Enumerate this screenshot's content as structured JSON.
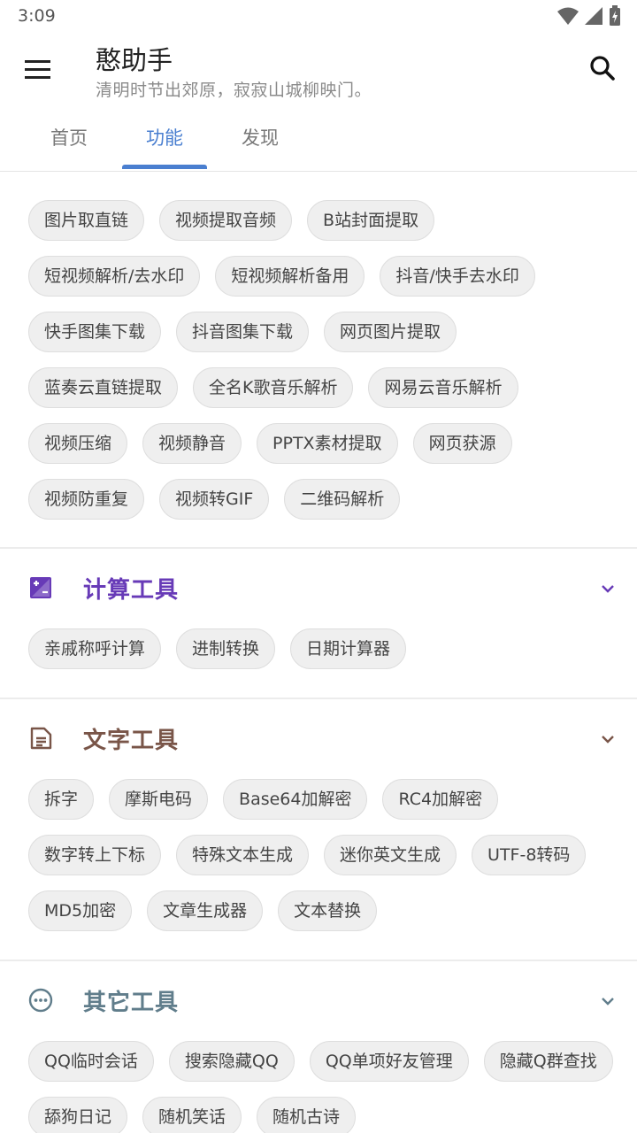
{
  "status_bar": {
    "time": "3:09"
  },
  "app_bar": {
    "title": "憨助手",
    "subtitle": "清明时节出郊原，寂寂山城柳映门。"
  },
  "tabs": [
    {
      "label": "首页"
    },
    {
      "label": "功能"
    },
    {
      "label": "发现"
    }
  ],
  "features": {
    "chips": [
      "图片取直链",
      "视频提取音频",
      "B站封面提取",
      "短视频解析/去水印",
      "短视频解析备用",
      "抖音/快手去水印",
      "快手图集下载",
      "抖音图集下载",
      "网页图片提取",
      "蓝奏云直链提取",
      "全名K歌音乐解析",
      "网易云音乐解析",
      "视频压缩",
      "视频静音",
      "PPTX素材提取",
      "网页获源",
      "视频防重复",
      "视频转GIF",
      "二维码解析"
    ]
  },
  "calc_tools": {
    "title": "计算工具",
    "color": "#673ab7",
    "icon": "calculator-icon",
    "chips": [
      "亲戚称呼计算",
      "进制转换",
      "日期计算器"
    ]
  },
  "text_tools": {
    "title": "文字工具",
    "color": "#795548",
    "icon": "document-icon",
    "chips": [
      "拆字",
      "摩斯电码",
      "Base64加解密",
      "RC4加解密",
      "数字转上下标",
      "特殊文本生成",
      "迷你英文生成",
      "UTF-8转码",
      "MD5加密",
      "文章生成器",
      "文本替换"
    ]
  },
  "other_tools": {
    "title": "其它工具",
    "color": "#607d8b",
    "icon": "more-horizontal-icon",
    "chips": [
      "QQ临时会话",
      "搜索隐藏QQ",
      "QQ单项好友管理",
      "隐藏Q群查找",
      "舔狗日记",
      "随机笑话",
      "随机古诗"
    ]
  }
}
